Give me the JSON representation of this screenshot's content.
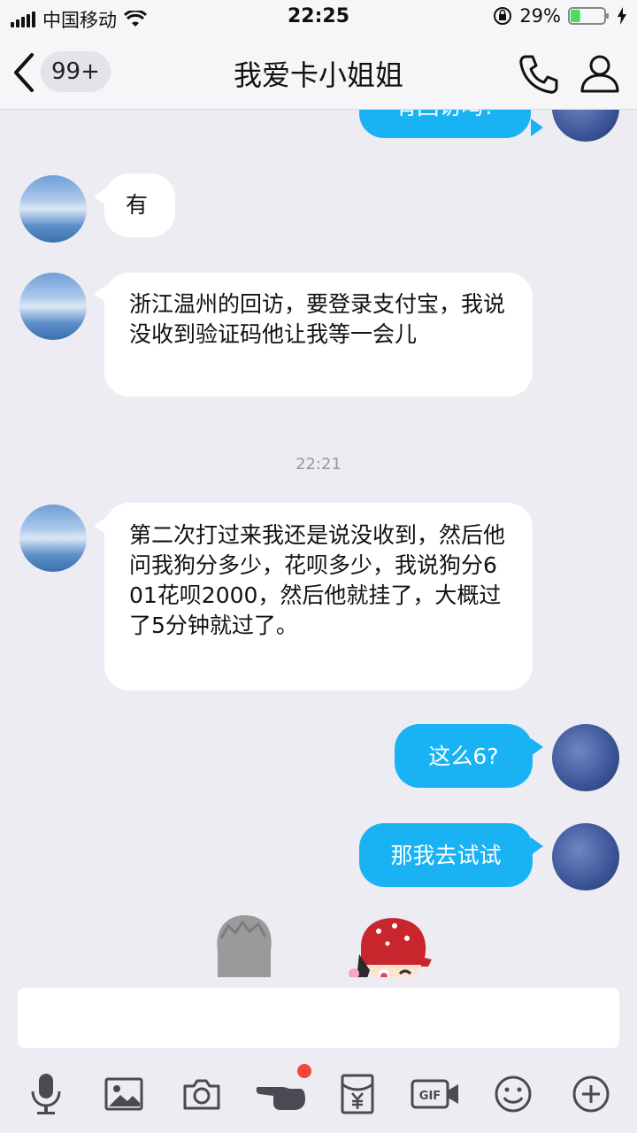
{
  "status_bar": {
    "carrier": "中国移动",
    "time": "22:25",
    "battery": "29%",
    "battery_level": 0.29
  },
  "nav": {
    "unread_count": "99+",
    "title": "我爱卡小姐姐",
    "back_icon": "chevron-left-icon",
    "call_icon": "phone-icon",
    "profile_icon": "person-icon"
  },
  "messages": [
    {
      "side": "out",
      "text": "有回访吗?"
    },
    {
      "side": "in",
      "text": "有"
    },
    {
      "side": "in",
      "text": "浙江温州的回访，要登录支付宝，我说没收到验证码他让我等一会儿"
    },
    {
      "side": "in",
      "text": "第二次打过来我还是说没收到，然后他问我狗分多少，花呗多少，我说狗分601花呗2000，然后他就挂了，大概过了5分钟就过了。"
    },
    {
      "side": "out",
      "text": "这么6?"
    },
    {
      "side": "out",
      "text": "那我去试试"
    }
  ],
  "timestamp": "22:21",
  "colors": {
    "outgoing_bubble": "#19b3f4",
    "incoming_bubble": "#ffffff",
    "background": "#ececf2",
    "notification_dot": "#f2463b"
  },
  "toolbar": {
    "items": [
      "microphone-icon",
      "image-icon",
      "camera-icon",
      "poke-icon",
      "red-packet-icon",
      "gif-icon",
      "emoji-icon",
      "plus-icon"
    ]
  }
}
